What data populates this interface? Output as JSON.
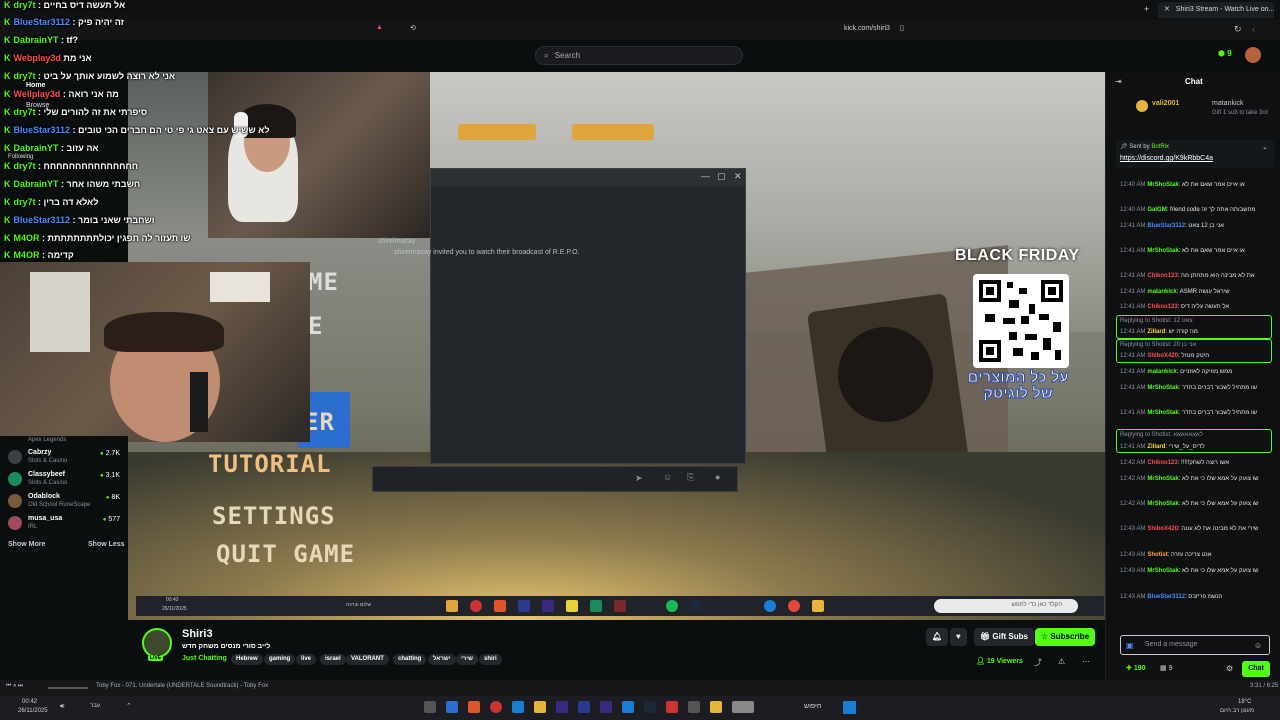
{
  "browser": {
    "tab_title": "Shiri3 Stream - Watch Live on...",
    "url": "kick.com/shiri3"
  },
  "overlay_chat": [
    {
      "user": "dry7t",
      "msg": "אל תעשה דיס בחיים"
    },
    {
      "user": "BlueStar3112",
      "msg": "זה יהיה פיק"
    },
    {
      "user": "DabrainYT",
      "msg": "tf?"
    },
    {
      "user": "Webplay3d",
      "msg": "אני מת"
    },
    {
      "user": "dry7t",
      "msg": "אני לא רוצה לשמוע אותך על ביט"
    },
    {
      "user": "Wellplay3d",
      "msg": "מה אני רואה"
    },
    {
      "user": "dry7t",
      "msg": "סיפרתי את זה להורים שלי"
    },
    {
      "user": "BlueStar3112",
      "msg": "לא ששיש עם צאט גי פי טי הם חברים הכי טובים"
    },
    {
      "user": "DabrainYT",
      "msg": "אה עזוב"
    },
    {
      "user": "dry7t",
      "msg": "חחחחחחחחחחחחחחח"
    },
    {
      "user": "DabrainYT",
      "msg": "חשבתי משהו אחר"
    },
    {
      "user": "dry7t",
      "msg": "לאלא דה ברין"
    },
    {
      "user": "BlueStar3112",
      "msg": "ושחבתי שאני בומר"
    },
    {
      "user": "M4OR",
      "msg": "שו תעזור לה תפגין יכולתתתתתתתת"
    },
    {
      "user": "M4OR",
      "msg": "קדימה"
    }
  ],
  "ghost_nav": [
    "Home",
    "Browse",
    "Following"
  ],
  "left_panel": {
    "top_category": "Apex Legends",
    "items": [
      {
        "name": "Cabrzy",
        "category": "Slots & Casino",
        "count": "2.7K"
      },
      {
        "name": "Classybeef",
        "category": "Slots & Casino",
        "count": "3.1K"
      },
      {
        "name": "Odablock",
        "category": "Old School RuneScape",
        "count": "8K"
      },
      {
        "name": "musa_usa",
        "category": "IRL",
        "count": "577"
      }
    ],
    "show_more": "Show More",
    "show_less": "Show Less"
  },
  "header": {
    "search_placeholder": "Search",
    "badge_count": "9"
  },
  "game": {
    "menu": [
      "TUTORIAL",
      "SETTINGS",
      "QUIT GAME"
    ],
    "menu_partial": [
      "ME",
      "E",
      "ER"
    ],
    "dialog_sender": "shirelmazay",
    "dialog_message": "shirelmazay invited you to watch their broadcast of R.E.P.O."
  },
  "ad": {
    "title": "BLACK FRIDAY",
    "subtitle": "על כל המוצרים של לוגיטק"
  },
  "video_taskbar": {
    "time": "00:42",
    "date": "26/11/2025",
    "search_placeholder": "הקלד כאן כדי לחפש",
    "weather": "שלום וברכה"
  },
  "channel": {
    "name": "Shiri3",
    "live_badge": "LIVE",
    "title": "לייב סורי מנסים משחק חדש",
    "category": "Just Chatting",
    "tags": [
      "Hebrew",
      "gaming",
      "live",
      "israel",
      "VALORANT",
      "chatting",
      "ישראל",
      "שירי",
      "shiri"
    ],
    "gift_subs": "Gift Subs",
    "subscribe": "Subscribe",
    "viewers": "19 Viewers"
  },
  "chat": {
    "title": "Chat",
    "gift": {
      "user": "vali2001",
      "gifter": "matankick",
      "text": "Gift 1 sub to take 3rd"
    },
    "pinned": {
      "label": "Sent by",
      "user": "BotRix",
      "link": "https://discord.gg/K9kRbbC4a"
    },
    "messages": [
      {
        "time": "12:40 AM",
        "user": "MrShoStak",
        "color": "#53fc18",
        "text": "או איים אמר שאם את לא"
      },
      {
        "time": "12:40 AM",
        "user": "GalGM",
        "color": "#53fc18",
        "text": "friend code מחשבותה אתה לך זה"
      },
      {
        "time": "12:41 AM",
        "user": "BlueStar3112",
        "color": "#4a8bff",
        "text": "אני בן 12 צאט"
      },
      {
        "time": "12:41 AM",
        "user": "MrShoStak",
        "color": "#53fc18",
        "text": "או איים אמר שאם את לא"
      },
      {
        "time": "12:41 AM",
        "user": "Chikno123",
        "color": "#ff4d4d",
        "text": "את לא מבינה הוא מתחתן מה"
      },
      {
        "time": "12:41 AM",
        "user": "matankick",
        "color": "#53fc18",
        "text": "ASMR שיראל עושה"
      },
      {
        "time": "12:41 AM",
        "user": "Chikno123",
        "color": "#ff4d4d",
        "text": "אל תעשה עליה דיס"
      },
      {
        "time": "12:41 AM",
        "user": "Zillard",
        "color": "#ffd33d",
        "text": "מה קורה יש"
      },
      {
        "time": "12:41 AM",
        "user": "ShiboX420",
        "color": "#ff4d4d",
        "text": "חיטק מנוזל"
      },
      {
        "time": "12:41 AM",
        "user": "matankick",
        "color": "#53fc18",
        "text": "ממש מוזיקה לאוזניים"
      },
      {
        "time": "12:41 AM",
        "user": "MrShoStak",
        "color": "#53fc18",
        "text": "שו מתחיל לשבור דברים בחדר"
      },
      {
        "time": "12:41 AM",
        "user": "MrShoStak",
        "color": "#53fc18",
        "text": "שו מתחיל לשבור דברים בחדר"
      },
      {
        "time": "12:41 AM",
        "user": "Zillard",
        "color": "#ffd33d",
        "text": "לדיס_על_שירי"
      },
      {
        "time": "12:42 AM",
        "user": "Chikno123",
        "color": "#ff4d4d",
        "text": "!!!!!אשו רוצה לשחק"
      },
      {
        "time": "12:42 AM",
        "user": "MrShoStak",
        "color": "#53fc18",
        "text": "שו צועק על אמא שלו כי את לא"
      },
      {
        "time": "12:42 AM",
        "user": "MrShoStak",
        "color": "#53fc18",
        "text": "שו צועק על אמא שלו כי את לא"
      },
      {
        "time": "12:43 AM",
        "user": "ShiboX420",
        "color": "#ff4d4d",
        "text": "שירי את לא מבינה את לא עונה"
      },
      {
        "time": "12:43 AM",
        "user": "Shotist",
        "color": "#ffa94d",
        "text": "אנט צריכה עזרה"
      },
      {
        "time": "12:43 AM",
        "user": "MrShoStak",
        "color": "#53fc18",
        "text": "שו צועק על אמא שלו כי את לא"
      },
      {
        "time": "12:43 AM",
        "user": "BlueStar3112",
        "color": "#4a8bff",
        "text": "הנשמ פריזבס"
      }
    ],
    "reply_labels": [
      "Replying to Shotist: 12 צאט",
      "Replying to Shotist: 20 אני בן",
      "Replying to Shotist: לאאאאאאא"
    ],
    "input_placeholder": "Send a message",
    "points": "190",
    "boxes": "9",
    "send": "Chat"
  },
  "media": {
    "track": "Toby Fox - 071. Undertale (UNDERTALE Soundtrack) - Toby Fox",
    "time": "3:31 / 6:25"
  },
  "taskbar": {
    "time": "00:42",
    "date": "26/11/2025",
    "lang": "עבר",
    "search": "חיפוש",
    "weather": "18°C",
    "weather_sub": "מעונן רב היום"
  }
}
